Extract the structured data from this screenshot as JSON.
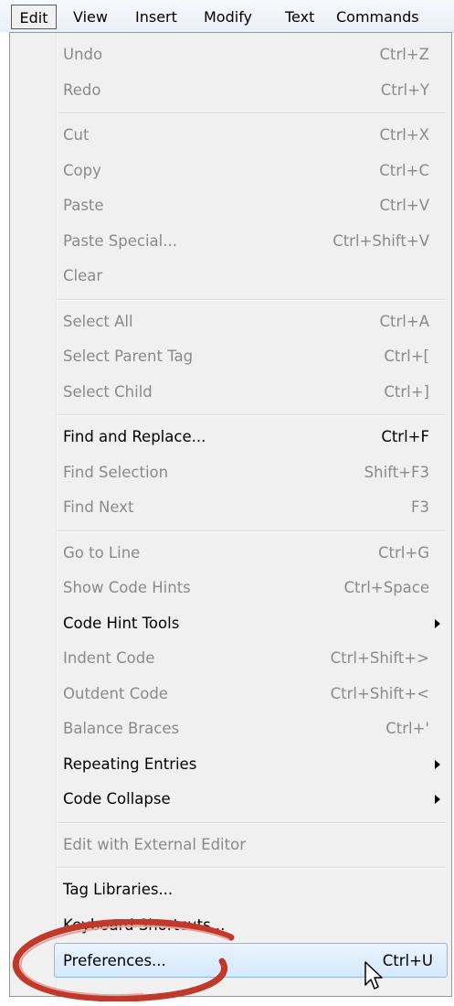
{
  "menubar": {
    "items": [
      "Edit",
      "View",
      "Insert",
      "Modify",
      "Text",
      "Commands"
    ],
    "active": "Edit"
  },
  "menu": {
    "items": [
      {
        "label": "Undo",
        "shortcut": "Ctrl+Z",
        "enabled": false
      },
      {
        "label": "Redo",
        "shortcut": "Ctrl+Y",
        "enabled": false
      },
      {
        "separator": true
      },
      {
        "label": "Cut",
        "shortcut": "Ctrl+X",
        "enabled": false
      },
      {
        "label": "Copy",
        "shortcut": "Ctrl+C",
        "enabled": false
      },
      {
        "label": "Paste",
        "shortcut": "Ctrl+V",
        "enabled": false
      },
      {
        "label": "Paste Special...",
        "shortcut": "Ctrl+Shift+V",
        "enabled": false
      },
      {
        "label": "Clear",
        "shortcut": "",
        "enabled": false
      },
      {
        "separator": true
      },
      {
        "label": "Select All",
        "shortcut": "Ctrl+A",
        "enabled": false
      },
      {
        "label": "Select Parent Tag",
        "shortcut": "Ctrl+[",
        "enabled": false
      },
      {
        "label": "Select Child",
        "shortcut": "Ctrl+]",
        "enabled": false
      },
      {
        "separator": true
      },
      {
        "label": "Find and Replace...",
        "shortcut": "Ctrl+F",
        "enabled": true
      },
      {
        "label": "Find Selection",
        "shortcut": "Shift+F3",
        "enabled": false
      },
      {
        "label": "Find Next",
        "shortcut": "F3",
        "enabled": false
      },
      {
        "separator": true
      },
      {
        "label": "Go to Line",
        "shortcut": "Ctrl+G",
        "enabled": false
      },
      {
        "label": "Show Code Hints",
        "shortcut": "Ctrl+Space",
        "enabled": false
      },
      {
        "label": "Code Hint Tools",
        "shortcut": "",
        "enabled": true,
        "submenu": true
      },
      {
        "label": "Indent Code",
        "shortcut": "Ctrl+Shift+>",
        "enabled": false
      },
      {
        "label": "Outdent Code",
        "shortcut": "Ctrl+Shift+<",
        "enabled": false
      },
      {
        "label": "Balance Braces",
        "shortcut": "Ctrl+'",
        "enabled": false
      },
      {
        "label": "Repeating Entries",
        "shortcut": "",
        "enabled": true,
        "submenu": true
      },
      {
        "label": "Code Collapse",
        "shortcut": "",
        "enabled": true,
        "submenu": true
      },
      {
        "separator": true
      },
      {
        "label": "Edit with External Editor",
        "shortcut": "",
        "enabled": false
      },
      {
        "separator": true
      },
      {
        "label": "Tag Libraries...",
        "shortcut": "",
        "enabled": true
      },
      {
        "label": "Keyboard Shortcuts...",
        "shortcut": "",
        "enabled": true
      },
      {
        "label": "Preferences...",
        "shortcut": "Ctrl+U",
        "enabled": true,
        "highlighted": true
      }
    ]
  },
  "colors": {
    "disabled_text": "#8a8a8a",
    "enabled_text": "#000000",
    "highlight_border": "#8fb7e8",
    "annotation_red": "#c0392b"
  }
}
